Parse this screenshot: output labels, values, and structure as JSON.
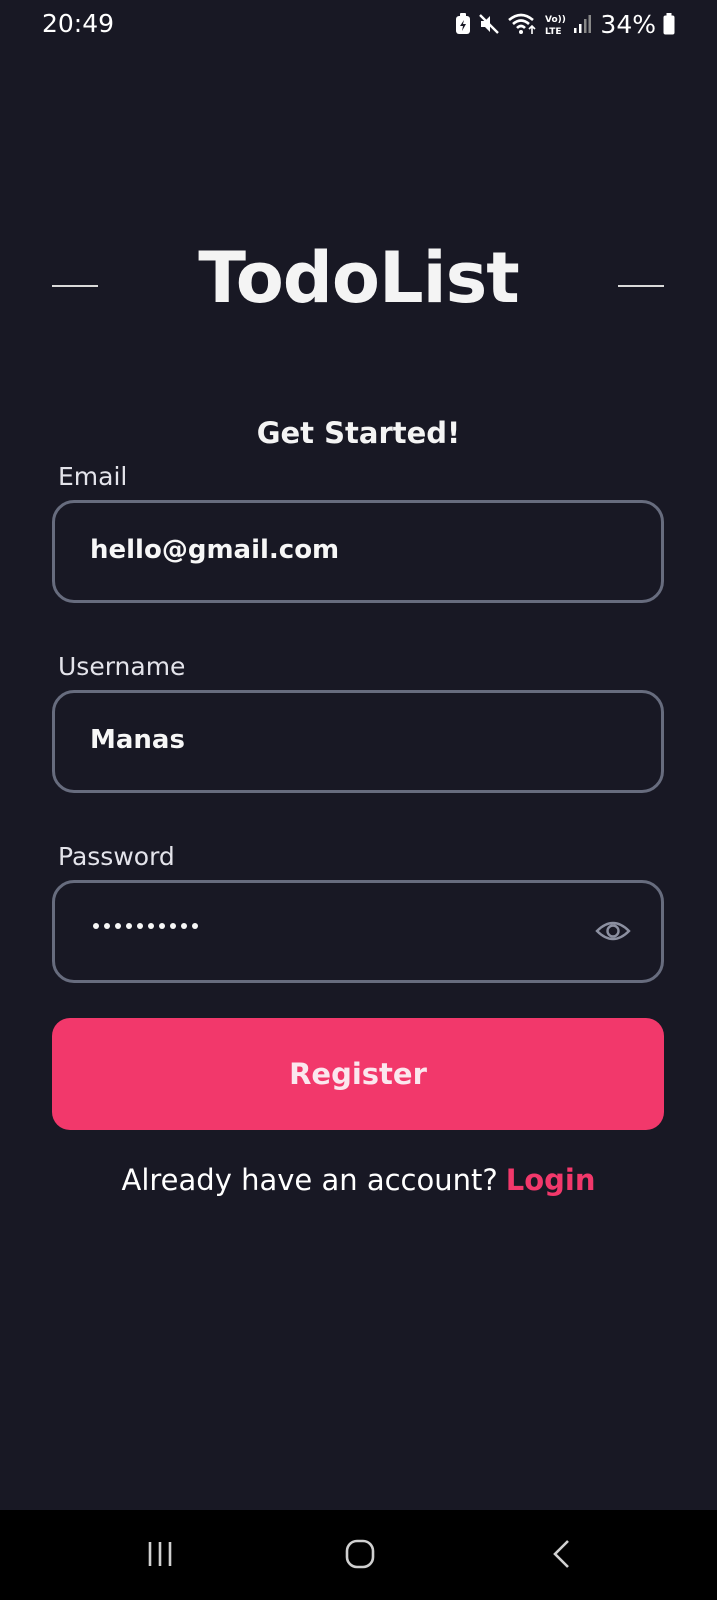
{
  "status_bar": {
    "time": "20:49",
    "battery": "34%",
    "icons": [
      "battery-saver-icon",
      "mute-icon",
      "wifi-icon",
      "volte-icon",
      "signal-icon",
      "battery-icon"
    ],
    "volte_label": "Vo)) LTE"
  },
  "header": {
    "title": "TodoList"
  },
  "form": {
    "subtitle": "Get Started!",
    "email_label": "Email",
    "email_value": "hello@gmail.com",
    "username_label": "Username",
    "username_value": "Manas",
    "password_label": "Password",
    "password_length": 10,
    "register_label": "Register"
  },
  "footer": {
    "prompt": "Already have an account?",
    "login_label": "Login"
  },
  "nav_bar": {
    "buttons": [
      "recent-apps-icon",
      "home-icon",
      "back-icon"
    ]
  },
  "colors": {
    "background": "#181824",
    "accent": "#f2386b",
    "field_border": "#676c7e"
  }
}
